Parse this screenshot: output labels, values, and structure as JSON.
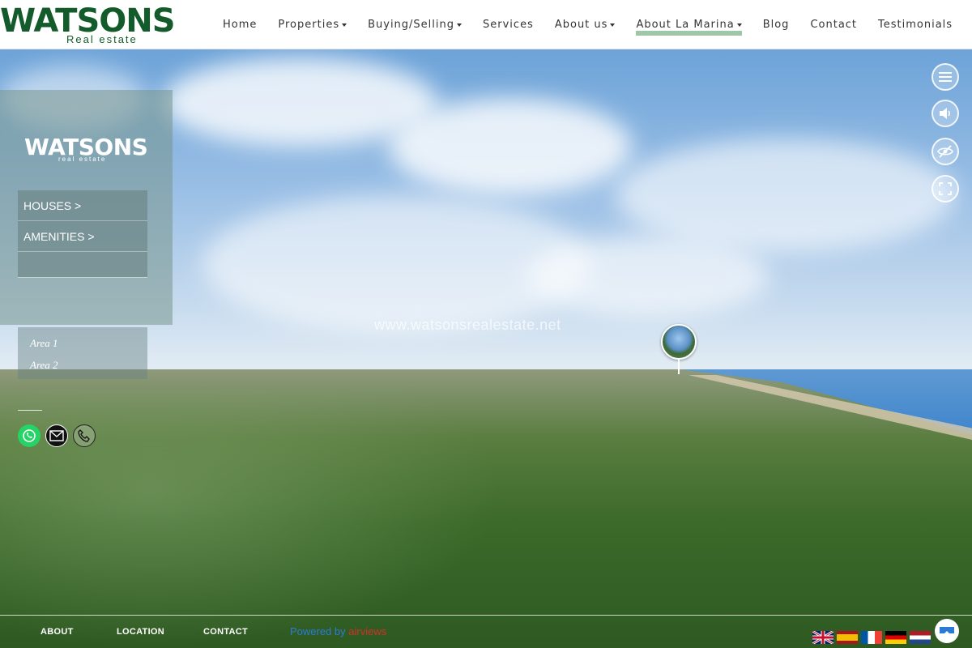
{
  "brand": {
    "name": "WATSONS",
    "tagline": "Real estate"
  },
  "nav": {
    "items": [
      {
        "label": "Home",
        "dropdown": false
      },
      {
        "label": "Properties",
        "dropdown": true
      },
      {
        "label": "Buying/Selling",
        "dropdown": true
      },
      {
        "label": "Services",
        "dropdown": false
      },
      {
        "label": "About us",
        "dropdown": true
      },
      {
        "label": "About La Marina",
        "dropdown": true,
        "active": true
      },
      {
        "label": "Blog",
        "dropdown": false
      },
      {
        "label": "Contact",
        "dropdown": false
      },
      {
        "label": "Testimonials",
        "dropdown": false
      }
    ]
  },
  "tour": {
    "watermark": "www.watsonsrealestate.net",
    "panel": {
      "logo": "WATSONS",
      "logo_sub": "real estate",
      "menu": [
        "HOUSES >",
        "AMENITIES >"
      ],
      "areas": [
        "Area 1",
        "Area 2"
      ]
    },
    "controls": [
      "menu-icon",
      "sound-icon",
      "hide-hotspots-icon",
      "fullscreen-icon"
    ],
    "contact_icons": [
      "whatsapp-icon",
      "email-icon",
      "phone-icon"
    ]
  },
  "footer": {
    "links": [
      "ABOUT",
      "LOCATION",
      "CONTACT"
    ],
    "powered_prefix": "Powered by",
    "powered_brand": "airviews",
    "languages": [
      "English",
      "Spanish",
      "French",
      "German",
      "Dutch"
    ]
  },
  "colors": {
    "brand_green": "#135b2a",
    "nav_active_underline": "#86b893",
    "powered_blue": "#2b7bd6",
    "powered_red": "#d0302b"
  }
}
